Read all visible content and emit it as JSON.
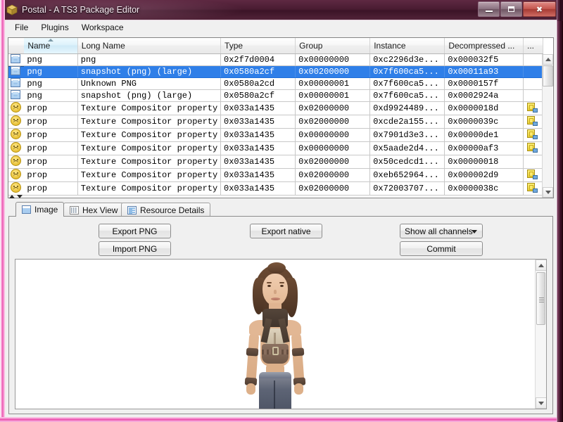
{
  "window": {
    "title": "Postal - A TS3 Package Editor",
    "icon": "package-box-icon",
    "minimize_label": "Minimize",
    "maximize_label": "Maximize",
    "close_label": "Close"
  },
  "menubar": {
    "items": [
      {
        "label": "File"
      },
      {
        "label": "Plugins"
      },
      {
        "label": "Workspace"
      }
    ]
  },
  "resource_table": {
    "columns": [
      {
        "key": "icon",
        "label": ""
      },
      {
        "key": "name",
        "label": "Name",
        "sorted": true
      },
      {
        "key": "long_name",
        "label": "Long Name"
      },
      {
        "key": "type",
        "label": "Type"
      },
      {
        "key": "group",
        "label": "Group"
      },
      {
        "key": "instance",
        "label": "Instance"
      },
      {
        "key": "decompressed",
        "label": "Decompressed ..."
      },
      {
        "key": "extra",
        "label": "..."
      }
    ],
    "rows": [
      {
        "icon": "image-icon",
        "name": "png",
        "long_name": "png",
        "type": "0x2f7d0004",
        "group": "0x00000000",
        "instance": "0xc2296d3e...",
        "decompressed": "0x000032f5",
        "extra": "",
        "selected": false
      },
      {
        "icon": "image-icon",
        "name": "png",
        "long_name": "snapshot (png) (large)",
        "type": "0x0580a2cf",
        "group": "0x00200000",
        "instance": "0x7f600ca5...",
        "decompressed": "0x00011a93",
        "extra": "",
        "selected": true
      },
      {
        "icon": "image-icon",
        "name": "png",
        "long_name": "Unknown PNG",
        "type": "0x0580a2cd",
        "group": "0x00000001",
        "instance": "0x7f600ca5...",
        "decompressed": "0x0000157f",
        "extra": "",
        "selected": false
      },
      {
        "icon": "image-icon",
        "name": "png",
        "long_name": "snapshot (png) (large)",
        "type": "0x0580a2cf",
        "group": "0x00000001",
        "instance": "0x7f600ca5...",
        "decompressed": "0x0002924a",
        "extra": "",
        "selected": false
      },
      {
        "icon": "prop-icon",
        "name": "prop",
        "long_name": "Texture Compositor property files",
        "type": "0x033a1435",
        "group": "0x02000000",
        "instance": "0xd9924489...",
        "decompressed": "0x0000018d",
        "extra": "compressed-icon",
        "selected": false
      },
      {
        "icon": "prop-icon",
        "name": "prop",
        "long_name": "Texture Compositor property files",
        "type": "0x033a1435",
        "group": "0x02000000",
        "instance": "0xcde2a155...",
        "decompressed": "0x0000039c",
        "extra": "compressed-icon",
        "selected": false
      },
      {
        "icon": "prop-icon",
        "name": "prop",
        "long_name": "Texture Compositor property files",
        "type": "0x033a1435",
        "group": "0x00000000",
        "instance": "0x7901d3e3...",
        "decompressed": "0x00000de1",
        "extra": "compressed-icon",
        "selected": false
      },
      {
        "icon": "prop-icon",
        "name": "prop",
        "long_name": "Texture Compositor property files",
        "type": "0x033a1435",
        "group": "0x00000000",
        "instance": "0x5aade2d4...",
        "decompressed": "0x00000af3",
        "extra": "compressed-icon",
        "selected": false
      },
      {
        "icon": "prop-icon",
        "name": "prop",
        "long_name": "Texture Compositor property files",
        "type": "0x033a1435",
        "group": "0x02000000",
        "instance": "0x50cedcd1...",
        "decompressed": "0x00000018",
        "extra": "",
        "selected": false
      },
      {
        "icon": "prop-icon",
        "name": "prop",
        "long_name": "Texture Compositor property files",
        "type": "0x033a1435",
        "group": "0x02000000",
        "instance": "0xeb652964...",
        "decompressed": "0x000002d9",
        "extra": "compressed-icon",
        "selected": false
      },
      {
        "icon": "prop-icon",
        "name": "prop",
        "long_name": "Texture Compositor property files",
        "type": "0x033a1435",
        "group": "0x02000000",
        "instance": "0x72003707...",
        "decompressed": "0x0000038c",
        "extra": "compressed-icon",
        "selected": false
      }
    ]
  },
  "tabs": [
    {
      "label": "Image",
      "icon": "image-icon",
      "active": true
    },
    {
      "label": "Hex View",
      "icon": "hex-grid-icon",
      "active": false
    },
    {
      "label": "Resource Details",
      "icon": "resource-details-icon",
      "active": false
    }
  ],
  "panel": {
    "export_png_label": "Export PNG",
    "import_png_label": "Import PNG",
    "export_native_label": "Export native",
    "channels_selected": "Show all channels",
    "commit_label": "Commit",
    "preview_alt": "sim-character-render"
  },
  "colors": {
    "window_border": "#ee63b8",
    "titlebar": "#4a1c32",
    "selection": "#2f7fe8",
    "panel_bg": "#f0f0f0"
  }
}
